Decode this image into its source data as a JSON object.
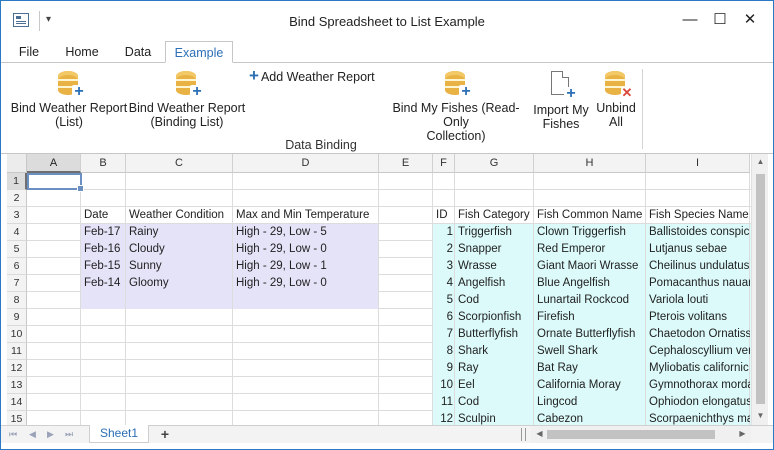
{
  "window": {
    "title": "Bind Spreadsheet to List Example",
    "minimize_glyph": "—",
    "maximize_glyph": "☐",
    "close_glyph": "✕",
    "qat_glyph": "▾"
  },
  "tabs": [
    {
      "label": "File"
    },
    {
      "label": "Home"
    },
    {
      "label": "Data"
    },
    {
      "label": "Example",
      "active": true
    }
  ],
  "ribbon": {
    "bind_list": "Bind Weather Report (List)",
    "bind_list_l1": "Bind Weather Report",
    "bind_list_l2": "(List)",
    "bind_binding_l1": "Bind Weather Report",
    "bind_binding_l2": "(Binding List)",
    "add_weather": "Add Weather Report",
    "bind_fishes_l1": "Bind My Fishes (Read-Only",
    "bind_fishes_l2": "Collection)",
    "import_l1": "Import My",
    "import_l2": "Fishes",
    "unbind_l1": "Unbind",
    "unbind_l2": "All",
    "group_label": "Data Binding",
    "accent_color": "#2b6fb5",
    "icon_names": [
      "database-add-icon",
      "database-add-icon",
      "add-icon",
      "database-add-icon",
      "document-add-icon",
      "database-remove-icon"
    ]
  },
  "grid": {
    "columns": [
      "A",
      "B",
      "C",
      "D",
      "E",
      "F",
      "G",
      "H",
      "I"
    ],
    "selected_column": "A",
    "rows": [
      "1",
      "2",
      "3",
      "4",
      "5",
      "6",
      "7",
      "8",
      "9",
      "10",
      "11",
      "12",
      "13",
      "14",
      "15"
    ],
    "selected_row": "1",
    "weather_headers": [
      "Date",
      "Weather Condition",
      "Max and Min Temperature"
    ],
    "weather_rows": [
      [
        "Feb-17",
        "Rainy",
        "High - 29, Low - 5"
      ],
      [
        "Feb-16",
        "Cloudy",
        "High - 29, Low - 0"
      ],
      [
        "Feb-15",
        "Sunny",
        "High - 29, Low - 1"
      ],
      [
        "Feb-14",
        "Gloomy",
        "High - 29, Low - 0"
      ]
    ],
    "fish_headers": [
      "ID",
      "Fish Category",
      "Fish Common Name",
      "Fish Species Name"
    ],
    "fish_rows": [
      [
        "1",
        "Triggerfish",
        "Clown Triggerfish",
        "Ballistoides conspicil"
      ],
      [
        "2",
        "Snapper",
        "Red Emperor",
        "Lutjanus sebae"
      ],
      [
        "3",
        "Wrasse",
        "Giant Maori Wrasse",
        "Cheilinus undulatus"
      ],
      [
        "4",
        "Angelfish",
        "Blue Angelfish",
        "Pomacanthus nauarc"
      ],
      [
        "5",
        "Cod",
        "Lunartail Rockcod",
        "Variola louti"
      ],
      [
        "6",
        "Scorpionfish",
        "Firefish",
        "Pterois volitans"
      ],
      [
        "7",
        "Butterflyfish",
        "Ornate Butterflyfish",
        "Chaetodon Ornatissi"
      ],
      [
        "8",
        "Shark",
        "Swell Shark",
        "Cephaloscyllium ven"
      ],
      [
        "9",
        "Ray",
        "Bat Ray",
        "Myliobatis californic"
      ],
      [
        "10",
        "Eel",
        "California Moray",
        "Gymnothorax morda"
      ],
      [
        "11",
        "Cod",
        "Lingcod",
        "Ophiodon elongatus"
      ],
      [
        "12",
        "Sculpin",
        "Cabezon",
        "Scorpaenichthys mar"
      ]
    ],
    "weather_fill": "#e5e3f8",
    "fish_fill": "#dcfafa"
  },
  "sheets": {
    "active": "Sheet1",
    "add_glyph": "+"
  }
}
